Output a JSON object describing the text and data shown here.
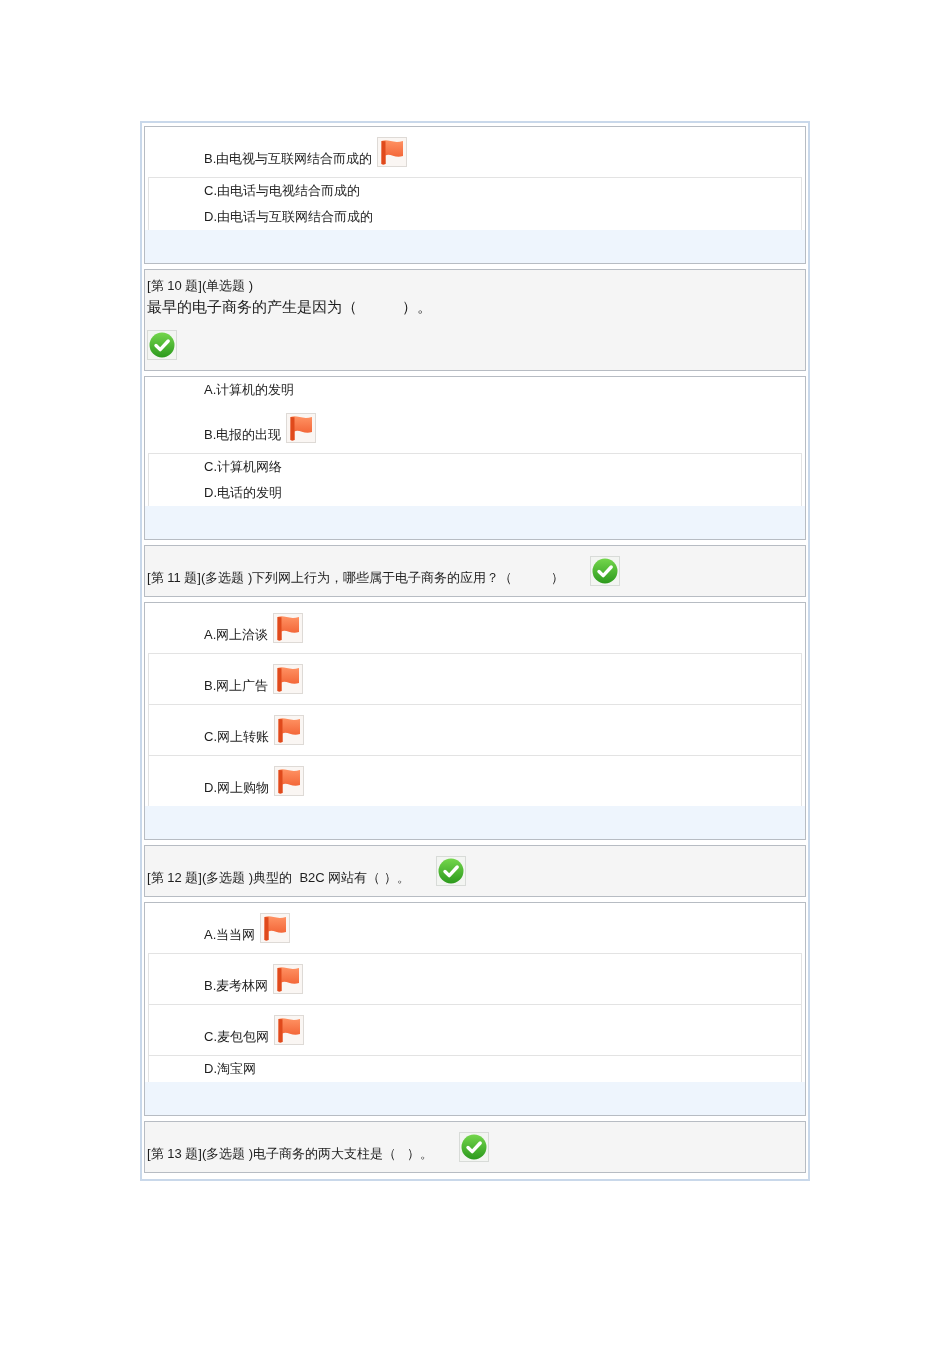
{
  "questions": [
    {
      "kind": "continued",
      "options": [
        {
          "label": "B.由电视与互联网结合而成的",
          "flagged": true
        },
        {
          "label": "C.由电话与电视结合而成的",
          "flagged": false
        },
        {
          "label": "D.由电话与互联网结合而成的",
          "flagged": false
        }
      ]
    },
    {
      "kind": "stacked",
      "tag": "[第 10 题](单选题 )",
      "text": "最早的电子商务的产生是因为（　　　）。",
      "marked_correct": true,
      "options": [
        {
          "label": "A.计算机的发明",
          "flagged": false
        },
        {
          "label": "B.电报的出现",
          "flagged": true
        },
        {
          "label": "C.计算机网络",
          "flagged": false
        },
        {
          "label": "D.电话的发明",
          "flagged": false
        }
      ]
    },
    {
      "kind": "inline",
      "text": "[第 11 题](多选题 )下列网上行为，哪些属于电子商务的应用？（　　　）",
      "marked_correct": true,
      "options": [
        {
          "label": "A.网上洽谈",
          "flagged": true
        },
        {
          "label": "B.网上广告",
          "flagged": true
        },
        {
          "label": "C.网上转账",
          "flagged": true
        },
        {
          "label": "D.网上购物",
          "flagged": true
        }
      ]
    },
    {
      "kind": "inline",
      "text": "[第 12 题](多选题 )典型的  B2C 网站有（ ）。",
      "marked_correct": true,
      "options": [
        {
          "label": "A.当当网",
          "flagged": true
        },
        {
          "label": "B.麦考林网",
          "flagged": true
        },
        {
          "label": "C.麦包包网",
          "flagged": true
        },
        {
          "label": "D.淘宝网",
          "flagged": false
        }
      ]
    },
    {
      "kind": "inline",
      "text": "[第 13 题](多选题 )电子商务的两大支柱是（   ）。",
      "marked_correct": true
    }
  ]
}
